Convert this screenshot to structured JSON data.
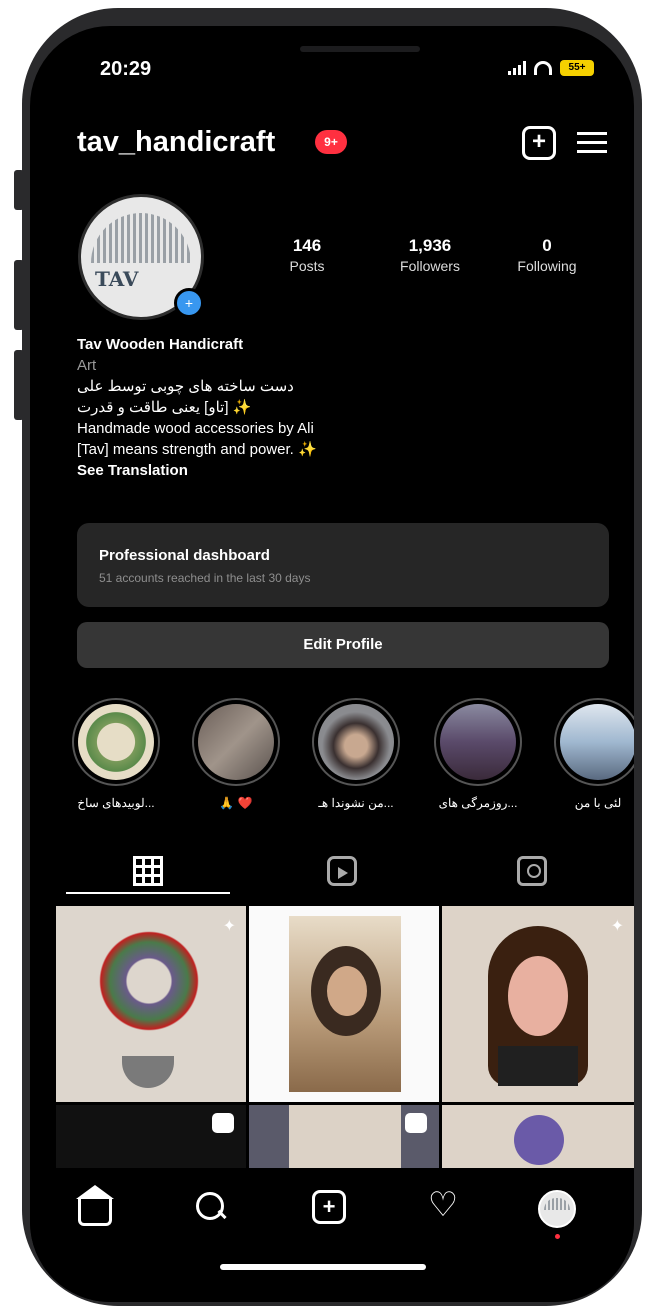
{
  "status_bar": {
    "time": "20:29",
    "battery": "55+"
  },
  "header": {
    "username": "tav_handicraft",
    "notification_count": "9+"
  },
  "profile": {
    "posts": {
      "count": "146",
      "label": "Posts"
    },
    "followers": {
      "count": "1,936",
      "label": "Followers"
    },
    "following": {
      "count": "0",
      "label": "Following"
    },
    "display_name": "Tav Wooden Handicraft",
    "category": "Art",
    "bio_lines": [
      "دست ساخته های چوبی توسط علی",
      "✨ [تاو] یعنی طاقت و قدرت",
      "Handmade wood accessories by Ali",
      "[Tav] means strength and power. ✨"
    ],
    "see_translation": "See Translation",
    "avatar_text": "TAV"
  },
  "dashboard": {
    "title": "Professional dashboard",
    "subtitle": "51 accounts reached in the last 30 days"
  },
  "edit_profile_label": "Edit Profile",
  "highlights": [
    {
      "caption": "لوبیدهای ساخ...",
      "color": "#e6ddc6"
    },
    {
      "caption": "🙏 ❤️",
      "color": "#7d6f68"
    },
    {
      "caption": "من نشوندا هـ...",
      "color": "#8a8b8f"
    },
    {
      "caption": "روزمرگی های...",
      "color": "#6a5a78"
    },
    {
      "caption": "لئی با من",
      "color": "#a0b8d0"
    }
  ],
  "tabs": [
    "posts-grid",
    "reels",
    "tagged"
  ],
  "nav": [
    "home",
    "search",
    "create",
    "activity",
    "profile"
  ]
}
